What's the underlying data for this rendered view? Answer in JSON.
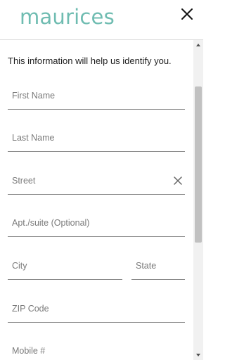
{
  "header": {
    "logo_text": "maurices",
    "brand_color": "#6fbcb1"
  },
  "icons": {
    "close": "close-icon",
    "clear": "clear-icon",
    "scroll_up": "triangle-up-icon",
    "scroll_down": "triangle-down-icon"
  },
  "form": {
    "intro": "This information will help us identify you.",
    "fields": {
      "first_name": "First Name",
      "last_name": "Last Name",
      "street": "Street",
      "apt": "Apt./suite (Optional)",
      "city": "City",
      "state": "State",
      "zip": "ZIP Code",
      "mobile": "Mobile #"
    }
  }
}
